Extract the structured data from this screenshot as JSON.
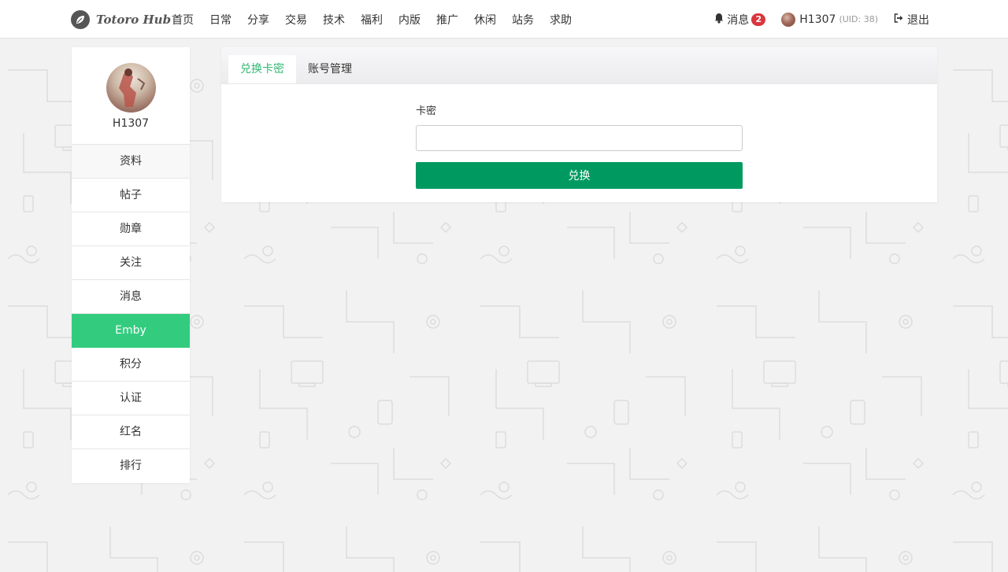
{
  "navbar": {
    "brand": "Totoro Hub",
    "links": [
      "首页",
      "日常",
      "分享",
      "交易",
      "技术",
      "福利",
      "内版",
      "推广",
      "休闲",
      "站务",
      "求助"
    ],
    "messages_label": "消息",
    "messages_count": "2",
    "username": "H1307",
    "uid": "(UID: 38)",
    "logout_label": "退出"
  },
  "sidebar": {
    "username": "H1307",
    "items": [
      "资料",
      "帖子",
      "勋章",
      "关注",
      "消息",
      "Emby",
      "积分",
      "认证",
      "红名",
      "排行"
    ],
    "active_item": "Emby"
  },
  "panel": {
    "tabs": [
      "兑换卡密",
      "账号管理"
    ],
    "active_tab": "兑换卡密",
    "field_label": "卡密",
    "field_value": "",
    "field_placeholder": "",
    "submit_label": "兑换"
  },
  "colors": {
    "accent": "#33cc7f",
    "button": "#009a61",
    "badge": "#d9363e",
    "tab_active_text": "#33b873"
  },
  "icons": {
    "brand": "leaf-icon",
    "messages": "bell-icon",
    "logout": "sign-out-icon"
  }
}
